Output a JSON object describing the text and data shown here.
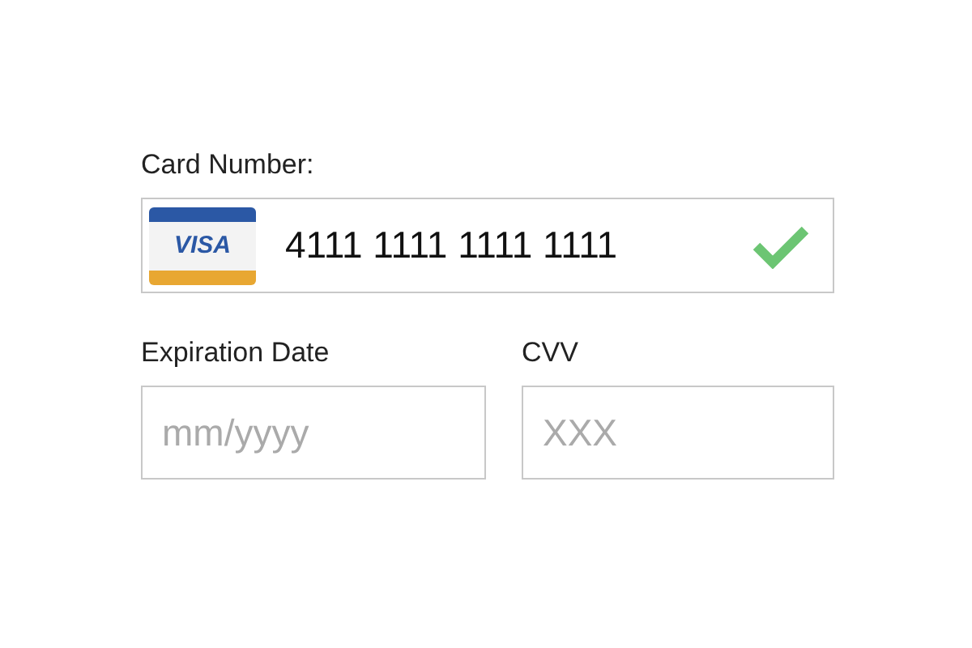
{
  "card_number": {
    "label": "Card Number:",
    "card_brand": "VISA",
    "value": "4111 1111 1111 1111",
    "valid": true
  },
  "expiration": {
    "label": "Expiration Date",
    "placeholder": "mm/yyyy"
  },
  "cvv": {
    "label": "CVV",
    "placeholder": "XXX"
  }
}
